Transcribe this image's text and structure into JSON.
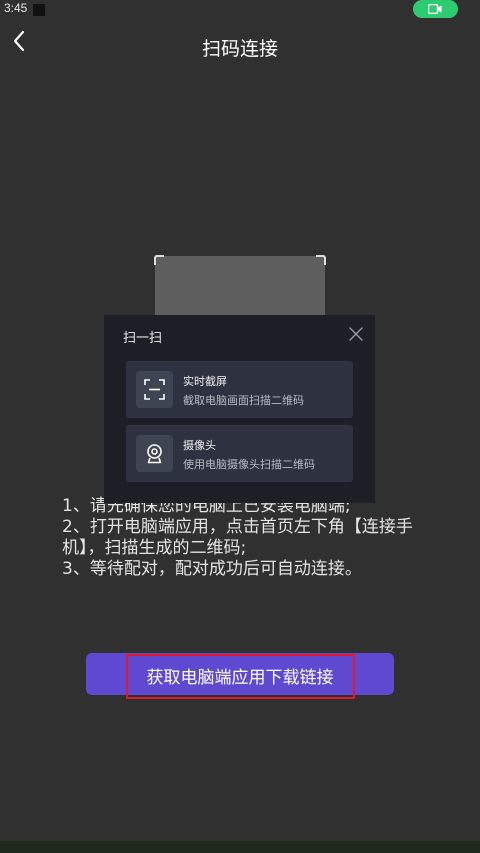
{
  "status": {
    "time": "3:45"
  },
  "header": {
    "title": "扫码连接"
  },
  "instructions": {
    "line1": "1、请先确保您的电脑上已安装电脑端;",
    "line2": "2、打开电脑端应用，点击首页左下角【连接手机】，扫描生成的二维码;",
    "line3": "3、等待配对，配对成功后可自动连接。"
  },
  "popup": {
    "title": "扫一扫",
    "options": [
      {
        "title": "实时截屏",
        "desc": "截取电脑画面扫描二维码",
        "icon": "scan-frame-icon"
      },
      {
        "title": "摄像头",
        "desc": "使用电脑摄像头扫描二维码",
        "icon": "camera-icon"
      }
    ]
  },
  "download": {
    "label": "获取电脑端应用下载链接"
  },
  "colors": {
    "accent": "#6049d1",
    "highlight": "#e0182d",
    "record": "#2ecc71",
    "background": "#303030"
  }
}
